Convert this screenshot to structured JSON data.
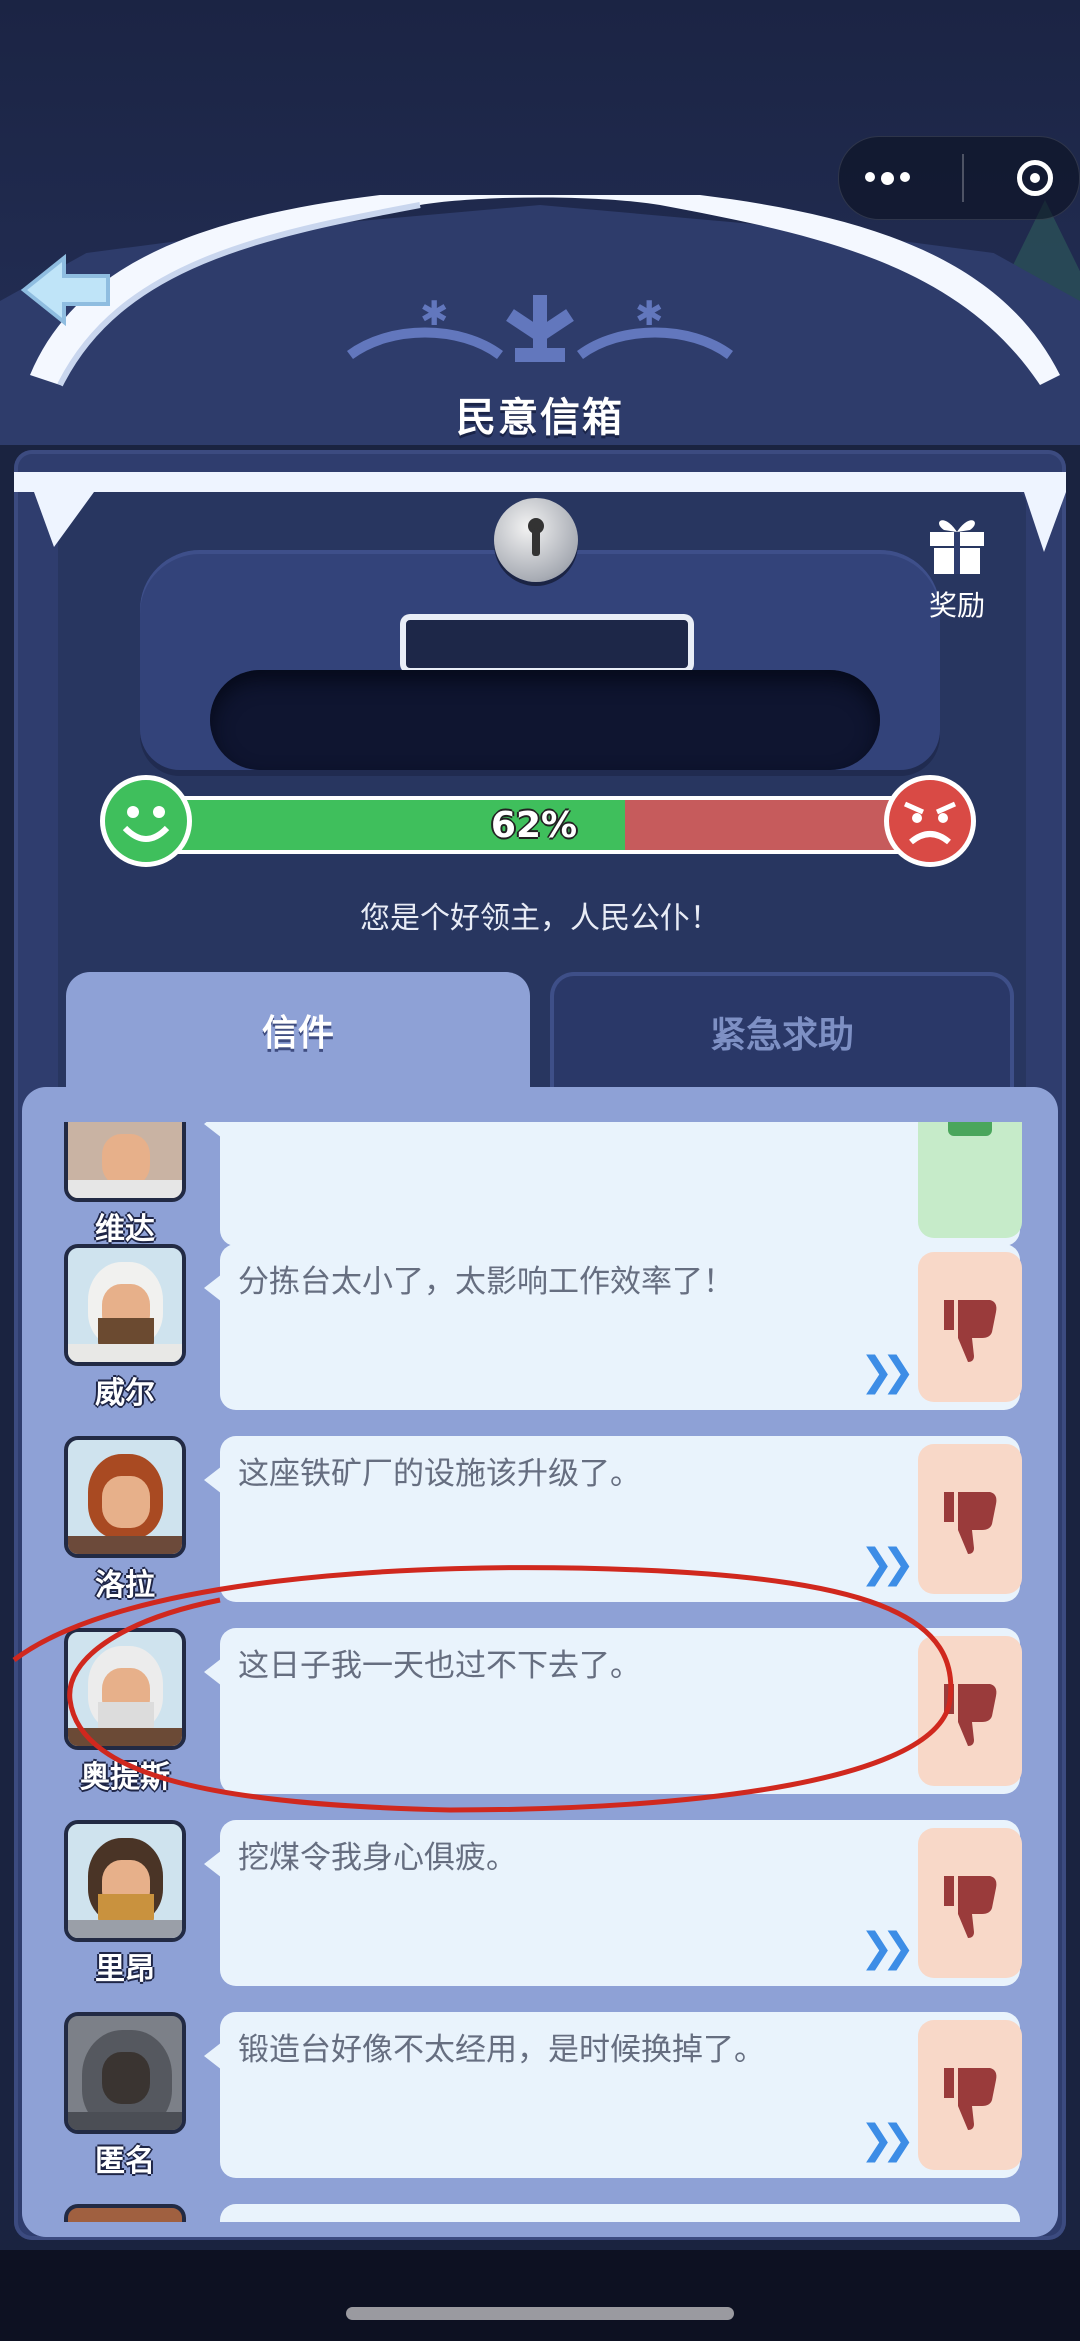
{
  "title": "民意信箱",
  "reward": {
    "label": "奖励"
  },
  "mood": {
    "percent_label": "62%",
    "value": 0.62,
    "status": "您是个好领主，人民公仆！"
  },
  "tabs": [
    {
      "label": "信件",
      "active": true
    },
    {
      "label": "紧急求助",
      "active": false
    }
  ],
  "letters": [
    {
      "name": "维达",
      "message": "",
      "action": "green"
    },
    {
      "name": "威尔",
      "message": "分拣台太小了，太影响工作效率了！",
      "action": "dislike"
    },
    {
      "name": "洛拉",
      "message": "这座铁矿厂的设施该升级了。",
      "action": "dislike"
    },
    {
      "name": "奥提斯",
      "message": "这日子我一天也过不下去了。",
      "action": "dislike"
    },
    {
      "name": "里昂",
      "message": "挖煤令我身心俱疲。",
      "action": "dislike"
    },
    {
      "name": "匿名",
      "message": "锻造台好像不太经用，是时候换掉了。",
      "action": "dislike"
    }
  ],
  "colors": {
    "accent": "#3fbf5c",
    "danger": "#c65b5c",
    "panel": "#8ea1d6",
    "annotation": "#d0281e"
  }
}
